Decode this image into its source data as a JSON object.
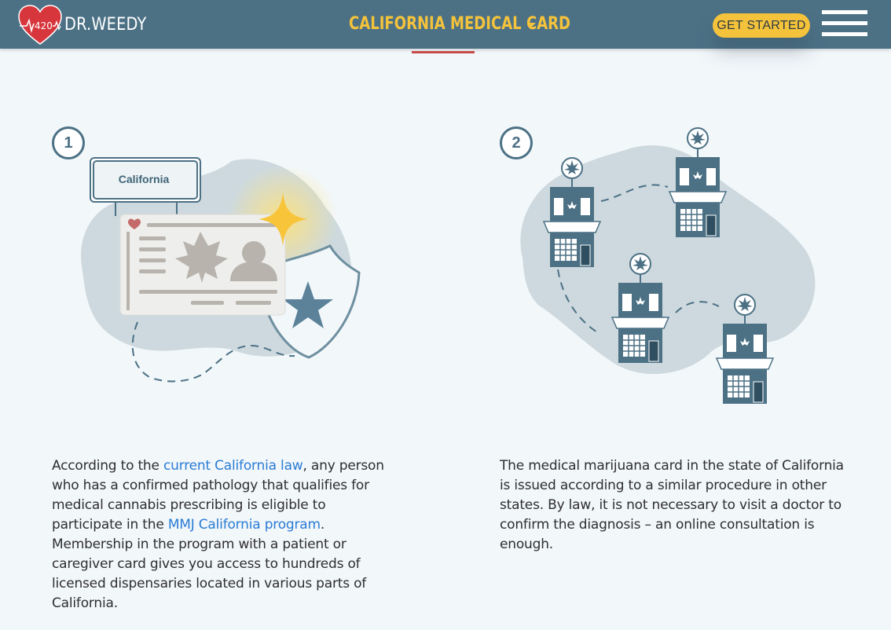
{
  "header": {
    "brand": "DR.WEEDY",
    "logo_icon": "heart-pulse-icon",
    "logo_number": "420",
    "nav_title": "CALIFORNIA MEDICAL CARD",
    "cta_label": "GET STARTED",
    "menu_icon": "hamburger-menu-icon"
  },
  "colors": {
    "header_bg": "#4c7185",
    "accent_yellow": "#f5c33b",
    "link_blue": "#2a7bd4",
    "underline_red": "#c94a4a"
  },
  "steps": [
    {
      "number": "1",
      "card_sign": "California",
      "text_before_link1": "According to the ",
      "link1": "current California law",
      "text_after_link1": ", any person who has a confirmed pathology that qualifies for medical cannabis prescribing is eligible to participate in the ",
      "link2": "MMJ California program",
      "text_after_link2": ". Membership in the program with a patient or caregiver card gives you access to hundreds of licensed dispensaries located in various parts of California."
    },
    {
      "number": "2",
      "text": "The medical marijuana card in the state of California is issued according to a similar procedure in other states. By law, it is not necessary to visit a doctor to confirm the diagnosis – an online consultation is enough."
    }
  ]
}
